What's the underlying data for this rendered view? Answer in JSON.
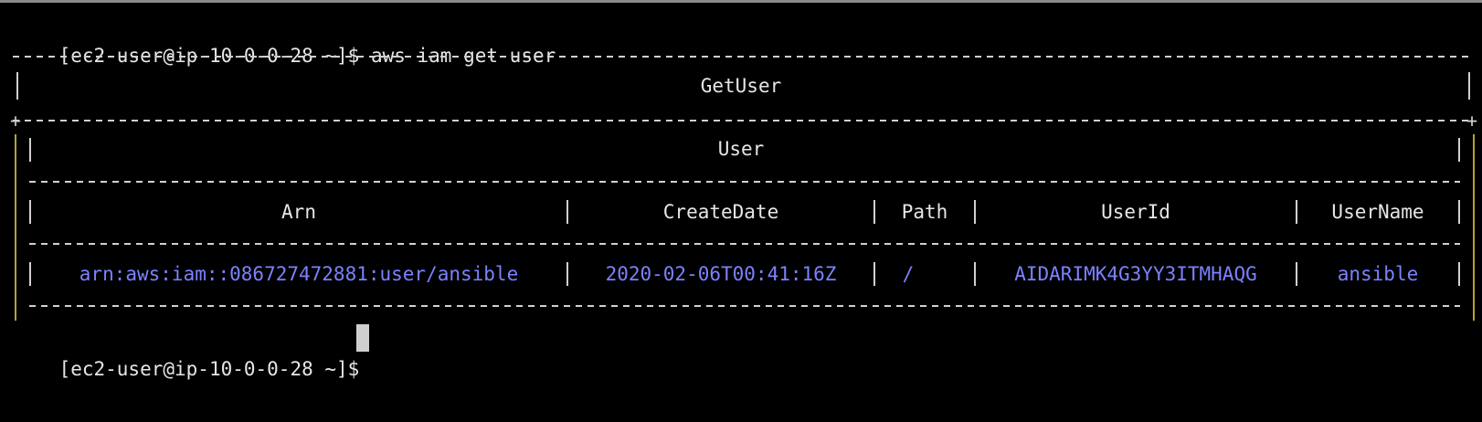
{
  "terminal": {
    "line1_prompt": "[ec2-user@ip-10-0-0-28 ~]$ ",
    "line1_command": "aws iam get-user",
    "table_title": "GetUser",
    "sub_title": "User",
    "columns": [
      "Arn",
      "CreateDate",
      "Path",
      "UserId",
      "UserName"
    ],
    "row": [
      "arn:aws:iam::086727472881:user/ansible",
      "2020-02-06T00:41:16Z",
      "/",
      "AIDARIMK4G3YY3ITMHAQG",
      "ansible"
    ],
    "line2_prompt": "[ec2-user@ip-10-0-0-28 ~]$ "
  },
  "colors": {
    "background": "#000000",
    "text": "#e6e6e6",
    "value_text": "#7b82ff",
    "border_accent": "#b8a232"
  }
}
